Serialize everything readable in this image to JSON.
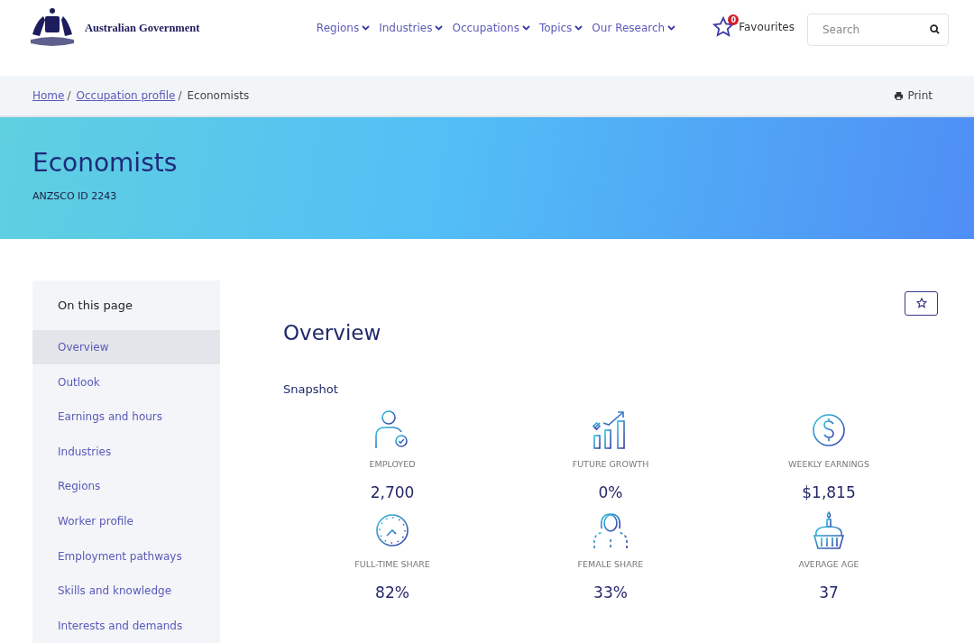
{
  "logo": {
    "text": "Australian Government"
  },
  "nav": [
    "Regions",
    "Industries",
    "Occupations",
    "Topics",
    "Our Research"
  ],
  "favourites": {
    "count": "0",
    "label": "Favourites"
  },
  "search": {
    "placeholder": "Search"
  },
  "breadcrumb_separator": "/",
  "breadcrumb": [
    {
      "label": "Home",
      "link": true
    },
    {
      "label": "Occupation profile",
      "link": true
    },
    {
      "label": "Economists",
      "link": false
    }
  ],
  "print": "Print",
  "hero": {
    "title": "Economists",
    "subtitle": "ANZSCO ID 2243"
  },
  "sidebar": {
    "title": "On this page",
    "items": [
      {
        "label": "Overview",
        "selected": true
      },
      {
        "label": "Outlook",
        "selected": false
      },
      {
        "label": "Earnings and hours",
        "selected": false
      },
      {
        "label": "Industries",
        "selected": false
      },
      {
        "label": "Regions",
        "selected": false
      },
      {
        "label": "Worker profile",
        "selected": false
      },
      {
        "label": "Employment pathways",
        "selected": false
      },
      {
        "label": "Skills and knowledge",
        "selected": false
      },
      {
        "label": "Interests and demands",
        "selected": false
      }
    ]
  },
  "main": {
    "title": "Overview",
    "section": "Snapshot",
    "stats": [
      {
        "kind": "person",
        "label": "EMPLOYED",
        "value": "2,700"
      },
      {
        "kind": "growth",
        "label": "FUTURE GROWTH",
        "value": "0%"
      },
      {
        "kind": "dollar",
        "label": "WEEKLY EARNINGS",
        "value": "$1,815"
      },
      {
        "kind": "clock",
        "label": "FULL-TIME SHARE",
        "value": "82%"
      },
      {
        "kind": "woman",
        "label": "FEMALE SHARE",
        "value": "33%"
      },
      {
        "kind": "cake",
        "label": "AVERAGE AGE",
        "value": "37"
      }
    ]
  }
}
